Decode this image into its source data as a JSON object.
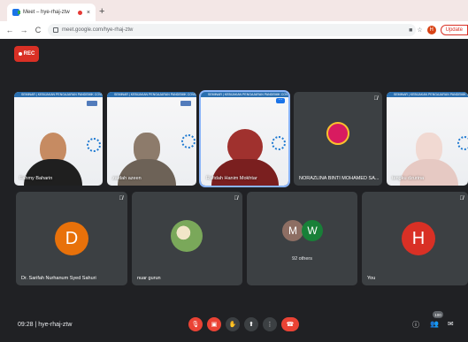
{
  "browser": {
    "tab_title": "Meet – hye-rhaj-ztw",
    "tab_close": "×",
    "new_tab": "+",
    "back": "←",
    "forward": "→",
    "reload": "C",
    "url": "meet.google.com/hye-rhaj-ztw",
    "profile_initial": "H",
    "update_label": "Update"
  },
  "meet": {
    "rec_label": "REC",
    "tiles_top": [
      {
        "name": "Fahmy Baharin",
        "muted": false
      },
      {
        "name": "zaidah azeen",
        "muted": false
      },
      {
        "name": "Rafidah Hanim Mokhtar",
        "muted": false,
        "selected": true
      },
      {
        "name": "NORAZLINA BINTI MOHAMED SA...",
        "muted": true
      },
      {
        "name": "tengku dzurina",
        "muted": false
      }
    ],
    "tiles_bottom": [
      {
        "name": "Dr. Sarifah Nurhanum Syed Sahuri",
        "initial": "D",
        "color": "#e8710a"
      },
      {
        "name": "nuar gurun",
        "initial": "",
        "color": "#6aa84f"
      },
      {
        "name": "",
        "others_initials": [
          "M",
          "W"
        ],
        "others_label": "92 others"
      },
      {
        "name": "You",
        "initial": "H",
        "color": "#d93025"
      }
    ],
    "banner_text": "SEMINAR | KEBIJAKAN PENGAJARAN PANDEMIK COVID-19",
    "more_options": "···"
  },
  "bottom_bar": {
    "time": "09:28",
    "separator": "|",
    "meeting_code": "hye-rhaj-ztw",
    "people_count": "100"
  }
}
